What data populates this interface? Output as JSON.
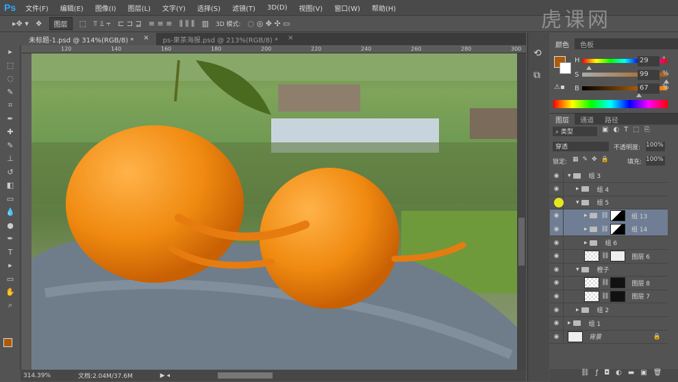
{
  "app": {
    "logo": "Ps"
  },
  "menu": [
    "文件(F)",
    "编辑(E)",
    "图像(I)",
    "图层(L)",
    "文字(Y)",
    "选择(S)",
    "滤镜(T)",
    "3D(D)",
    "视图(V)",
    "窗口(W)",
    "帮助(H)"
  ],
  "options": {
    "auto_select": "图层",
    "mode3d": "3D 模式:"
  },
  "tabs": [
    {
      "label": "未标题-1.psd @ 314%(RGB/8) *",
      "close": "×"
    },
    {
      "label": "ps-果茶海报.psd @ 213%(RGB/8) *",
      "close": "×"
    }
  ],
  "ruler": [
    "120",
    "140",
    "160",
    "180",
    "200",
    "220",
    "240",
    "260",
    "280",
    "300"
  ],
  "status": {
    "zoom": "314.39%",
    "doc": "文档:2.04M/37.6M"
  },
  "color_panel": {
    "tabs": [
      "颜色",
      "色板"
    ],
    "h": "29",
    "h_unit": "°",
    "s": "99",
    "s_unit": "%",
    "b": "67",
    "b_unit": "%",
    "fg": "#ab5a0a",
    "h_frac": 0.08,
    "s_frac": 0.99,
    "b_frac": 0.67
  },
  "watermark": "虎课网",
  "layers_panel": {
    "tabs": [
      "图层",
      "通道",
      "路径"
    ],
    "filter": "类型",
    "blend": "穿透",
    "opacity_label": "不透明度:",
    "opacity": "100%",
    "lock_label": "锁定:",
    "fill_label": "填充:",
    "fill": "100%",
    "rows": [
      {
        "name": "组 3",
        "type": "group",
        "indent": 0,
        "open": true
      },
      {
        "name": "组 4",
        "type": "group",
        "indent": 1
      },
      {
        "name": "组 5",
        "type": "group",
        "indent": 1,
        "open": true
      },
      {
        "name": "组 13",
        "type": "group-mask",
        "indent": 2,
        "selected": true
      },
      {
        "name": "组 14",
        "type": "group-mask",
        "indent": 2,
        "selected": true
      },
      {
        "name": "组 6",
        "type": "group",
        "indent": 2
      },
      {
        "name": "图层 6",
        "type": "layer",
        "indent": 2
      },
      {
        "name": "橙子",
        "type": "group",
        "indent": 1,
        "open": true
      },
      {
        "name": "图层 8",
        "type": "layer",
        "indent": 2
      },
      {
        "name": "图层 7",
        "type": "layer",
        "indent": 2
      },
      {
        "name": "组 2",
        "type": "group",
        "indent": 1
      },
      {
        "name": "组 1",
        "type": "group",
        "indent": 0
      },
      {
        "name": "背景",
        "type": "bg",
        "indent": 0
      }
    ]
  }
}
